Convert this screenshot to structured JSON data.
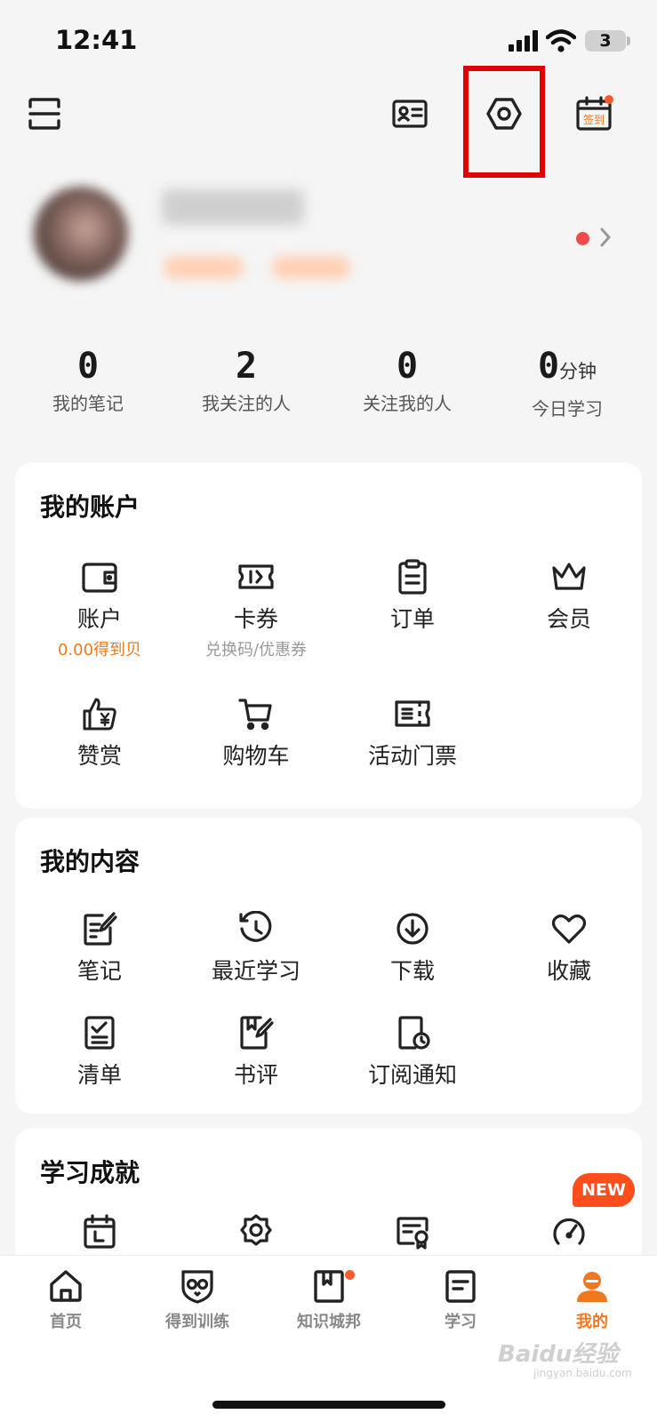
{
  "status_bar": {
    "time": "12:41",
    "battery": "3"
  },
  "top_bar": {
    "checkin_label": "签到"
  },
  "stats": [
    {
      "value": "0",
      "unit": "",
      "label": "我的笔记"
    },
    {
      "value": "2",
      "unit": "",
      "label": "我关注的人"
    },
    {
      "value": "0",
      "unit": "",
      "label": "关注我的人"
    },
    {
      "value": "0",
      "unit": "分钟",
      "label": "今日学习"
    }
  ],
  "account": {
    "title": "我的账户",
    "items": [
      {
        "label": "账户",
        "sub": "0.00得到贝",
        "icon": "wallet-icon"
      },
      {
        "label": "卡券",
        "sub": "兑换码/优惠券",
        "icon": "coupon-icon"
      },
      {
        "label": "订单",
        "sub": "",
        "icon": "order-clipboard-icon"
      },
      {
        "label": "会员",
        "sub": "",
        "icon": "crown-icon"
      },
      {
        "label": "赞赏",
        "sub": "",
        "icon": "thumbs-up-yen-icon"
      },
      {
        "label": "购物车",
        "sub": "",
        "icon": "shopping-cart-icon"
      },
      {
        "label": "活动门票",
        "sub": "",
        "icon": "ticket-icon"
      }
    ]
  },
  "content": {
    "title": "我的内容",
    "items": [
      {
        "label": "笔记",
        "icon": "note-edit-icon"
      },
      {
        "label": "最近学习",
        "icon": "history-clock-icon"
      },
      {
        "label": "下载",
        "icon": "download-icon"
      },
      {
        "label": "收藏",
        "icon": "heart-icon"
      },
      {
        "label": "清单",
        "icon": "checklist-icon"
      },
      {
        "label": "书评",
        "icon": "book-review-icon"
      },
      {
        "label": "订阅通知",
        "icon": "subscription-notice-icon"
      }
    ]
  },
  "achievements": {
    "title": "学习成就",
    "new_badge": "NEW",
    "icons": [
      "calendar-icon",
      "medal-icon",
      "certificate-icon",
      "gauge-icon"
    ]
  },
  "bottom_nav": [
    {
      "label": "首页",
      "icon": "home-icon",
      "active": false
    },
    {
      "label": "得到训练",
      "icon": "owl-shield-icon",
      "active": false
    },
    {
      "label": "知识城邦",
      "icon": "bookmark-book-icon",
      "active": false
    },
    {
      "label": "学习",
      "icon": "study-doc-icon",
      "active": false
    },
    {
      "label": "我的",
      "icon": "profile-icon",
      "active": true
    }
  ],
  "watermark": {
    "text": "Baidu经验",
    "sub": "jingyan.baidu.com"
  },
  "colors": {
    "accent": "#f07820",
    "highlight": "#e00000",
    "badge": "#ff4d1c"
  }
}
